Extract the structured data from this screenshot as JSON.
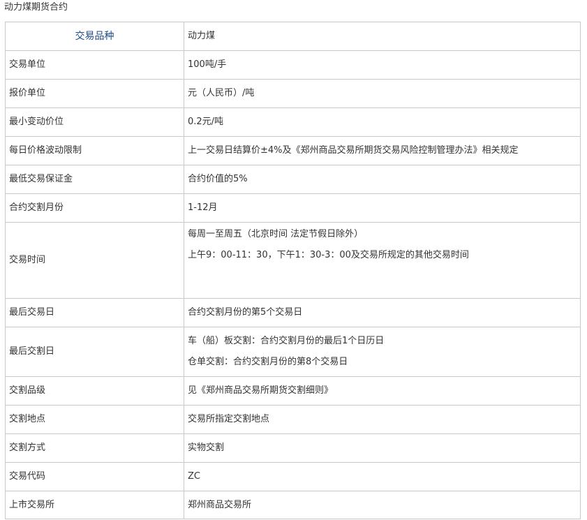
{
  "page_title": "动力煤期货合约",
  "header": {
    "label": "交易品种",
    "value": "动力煤"
  },
  "rows": [
    {
      "label": "交易单位",
      "value": "100吨/手"
    },
    {
      "label": "报价单位",
      "value": "元（人民币）/吨"
    },
    {
      "label": "最小变动价位",
      "value": "0.2元/吨"
    },
    {
      "label": "每日价格波动限制",
      "value": "上一交易日结算价±4%及《郑州商品交易所期货交易风险控制管理办法》相关规定"
    },
    {
      "label": "最低交易保证金",
      "value": "合约价值的5%"
    },
    {
      "label": "合约交割月份",
      "value": "1-12月"
    },
    {
      "label": "交易时间",
      "lines": [
        "每周一至周五（北京时间 法定节假日除外）",
        "上午9：00-11：30，下午1：30-3：00及交易所规定的其他交易时间"
      ]
    },
    {
      "label": "最后交易日",
      "value": "合约交割月份的第5个交易日"
    },
    {
      "label": "最后交割日",
      "lines": [
        "车（船）板交割：合约交割月份的最后1个日历日",
        "仓单交割：合约交割月份的第8个交易日"
      ]
    },
    {
      "label": "交割品级",
      "value": "见《郑州商品交易所期货交割细则》"
    },
    {
      "label": "交割地点",
      "value": "交易所指定交割地点"
    },
    {
      "label": "交割方式",
      "value": "实物交割"
    },
    {
      "label": "交易代码",
      "value": "ZC"
    },
    {
      "label": "上市交易所",
      "value": "郑州商品交易所"
    }
  ]
}
